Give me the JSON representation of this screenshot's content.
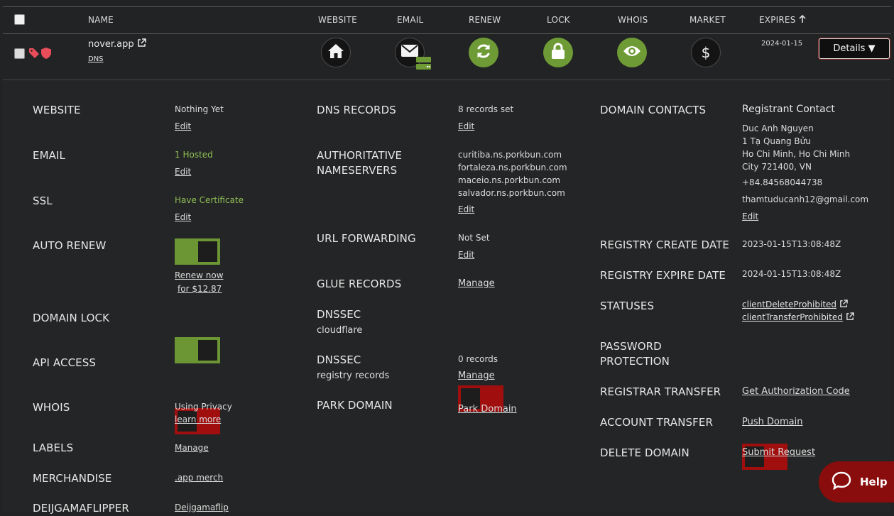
{
  "header": {
    "name": "NAME",
    "website": "WEBSITE",
    "email": "EMAIL",
    "renew": "RENEW",
    "lock": "LOCK",
    "whois": "WHOIS",
    "market": "MARKET",
    "expires": "EXPIRES",
    "expires_sort_icon": "arrow-up-icon"
  },
  "domain_row": {
    "name": "nover.app",
    "dns_link": "DNS",
    "expires": "2024-01-15",
    "details_button": "Details ▼",
    "colors": {
      "tag_icon": "#ea4d5a",
      "accent_green": "#6e9b35",
      "toggle_off": "#a00e0e"
    }
  },
  "col1": {
    "website": {
      "label": "WEBSITE",
      "value": "Nothing Yet",
      "action": "Edit"
    },
    "email": {
      "label": "EMAIL",
      "value": "1 Hosted",
      "action": "Edit"
    },
    "ssl": {
      "label": "SSL",
      "value": "Have Certificate",
      "action": "Edit"
    },
    "auto_renew": {
      "label": "AUTO RENEW",
      "state": "on",
      "renew_line1": "Renew now",
      "renew_line2": "for $12.87"
    },
    "domain_lock": {
      "label": "DOMAIN LOCK",
      "state": "on"
    },
    "api_access": {
      "label": "API ACCESS",
      "state": "off"
    },
    "whois": {
      "label": "WHOIS",
      "value": "Using Privacy",
      "action": "learn more"
    },
    "labels": {
      "label": "LABELS",
      "action": "Manage"
    },
    "merchandise": {
      "label": "MERCHANDISE",
      "action": ".app merch"
    },
    "flipper": {
      "label": "DEIJGAMAFLIPPER",
      "action": "Deijgamaflip"
    }
  },
  "col2": {
    "dns_records": {
      "label": "DNS RECORDS",
      "value": "8 records set",
      "action": "Edit"
    },
    "nameservers": {
      "label_line1": "AUTHORITATIVE",
      "label_line2": "NAMESERVERS",
      "servers": [
        "curitiba.ns.porkbun.com",
        "fortaleza.ns.porkbun.com",
        "maceio.ns.porkbun.com",
        "salvador.ns.porkbun.com"
      ],
      "action": "Edit"
    },
    "url_forwarding": {
      "label": "URL FORWARDING",
      "value": "Not Set",
      "action": "Edit"
    },
    "glue_records": {
      "label": "GLUE RECORDS",
      "action": "Manage"
    },
    "dnssec_cf": {
      "label": "DNSSEC",
      "sublabel": "cloudflare",
      "state": "off"
    },
    "dnssec_reg": {
      "label": "DNSSEC",
      "sublabel": "registry records",
      "value": "0 records",
      "action": "Manage"
    },
    "park_domain": {
      "label": "PARK DOMAIN",
      "action": "Park Domain"
    }
  },
  "col3": {
    "contacts": {
      "label": "DOMAIN CONTACTS",
      "title": "Registrant Contact",
      "name": "Duc Anh Nguyen",
      "address1": "1 Tạ Quang Bửu",
      "address2": "Ho Chi Minh, Ho Chi Minh",
      "address3": "City 721400, VN",
      "phone": "+84.84568044738",
      "email": "thamtuducanh12@gmail.com",
      "action": "Edit"
    },
    "create_date": {
      "label": "REGISTRY CREATE DATE",
      "value": "2023-01-15T13:08:48Z"
    },
    "expire_date": {
      "label": "REGISTRY EXPIRE DATE",
      "value": "2024-01-15T13:08:48Z"
    },
    "statuses": {
      "label": "STATUSES",
      "items": [
        "clientDeleteProhibited",
        "clientTransferProhibited"
      ]
    },
    "password": {
      "label_line1": "PASSWORD",
      "label_line2": "PROTECTION",
      "state": "off"
    },
    "registrar_transfer": {
      "label": "REGISTRAR TRANSFER",
      "action": "Get Authorization Code"
    },
    "account_transfer": {
      "label": "ACCOUNT TRANSFER",
      "action": "Push Domain"
    },
    "delete_domain": {
      "label": "DELETE DOMAIN",
      "action": "Submit Request"
    }
  },
  "help": {
    "label": "Help",
    "icon": "chat-bubble-icon"
  }
}
